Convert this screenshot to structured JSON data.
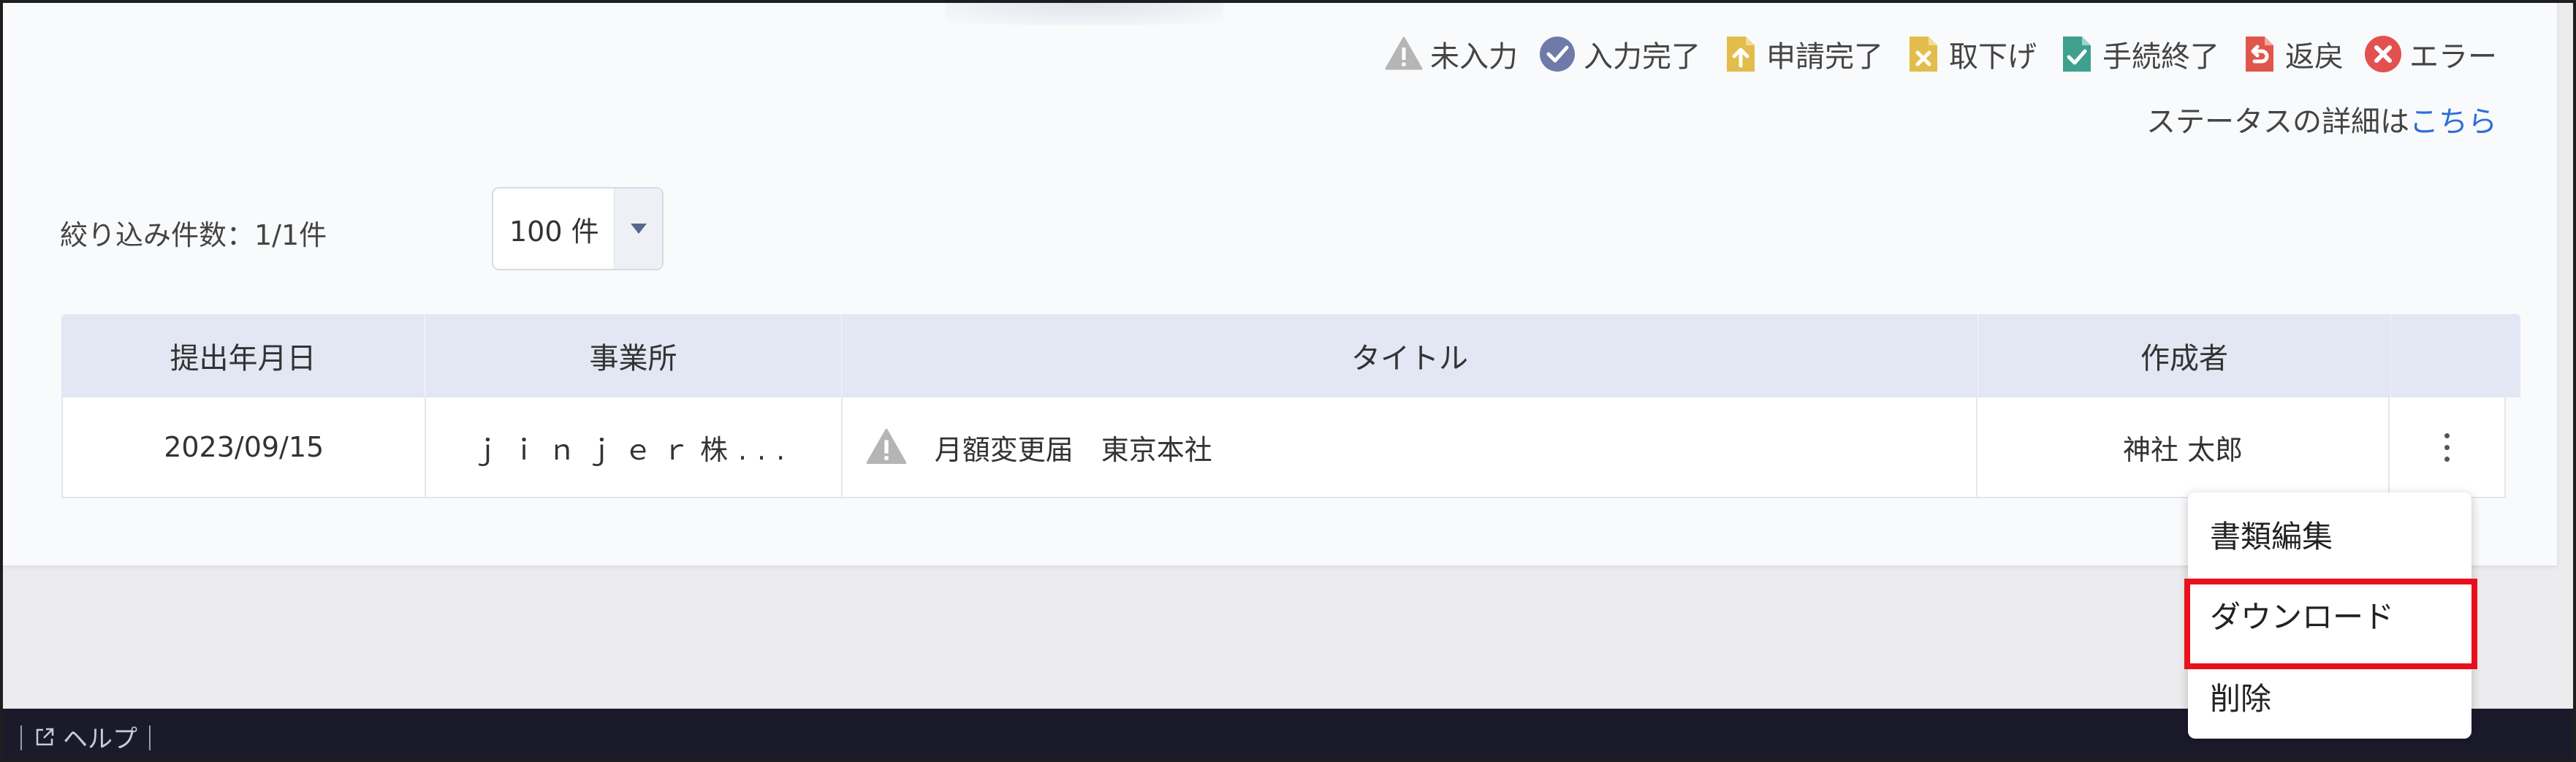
{
  "legend": [
    {
      "icon": "warning-triangle-icon",
      "label": "未入力",
      "color": "#b5b5b5"
    },
    {
      "icon": "check-circle-icon",
      "label": "入力完了",
      "color": "#6f7aa8"
    },
    {
      "icon": "upload-doc-icon",
      "label": "申請完了",
      "color": "#e2bd4c"
    },
    {
      "icon": "cancel-doc-icon",
      "label": "取下げ",
      "color": "#e2bd4c"
    },
    {
      "icon": "complete-doc-icon",
      "label": "手続終了",
      "color": "#3fa08e"
    },
    {
      "icon": "return-doc-icon",
      "label": "返戻",
      "color": "#e1564c"
    },
    {
      "icon": "error-circle-icon",
      "label": "エラー",
      "color": "#e25050"
    }
  ],
  "status_note": {
    "text": "ステータスの詳細は",
    "link": "こちら"
  },
  "filter": {
    "count_label": "絞り込み件数：1/1件",
    "per_page": "100 件"
  },
  "table": {
    "headers": [
      "提出年月日",
      "事業所",
      "タイトル",
      "作成者",
      ""
    ],
    "rows": [
      {
        "date": "2023/09/15",
        "office": "ｊｉｎｊｅｒ株...",
        "title": "月額変更届　東京本社",
        "author": "神社 太郎",
        "status_icon": "warning-triangle-icon"
      }
    ]
  },
  "menu": {
    "items": [
      "書類編集",
      "ダウンロード",
      "削除"
    ]
  },
  "footer": {
    "help": "ヘルプ"
  },
  "colors": {
    "header_bg": "#e3e6f3",
    "link": "#2f6fd6",
    "highlight": "#e8101a",
    "footer_bg": "#1b1a2a"
  }
}
